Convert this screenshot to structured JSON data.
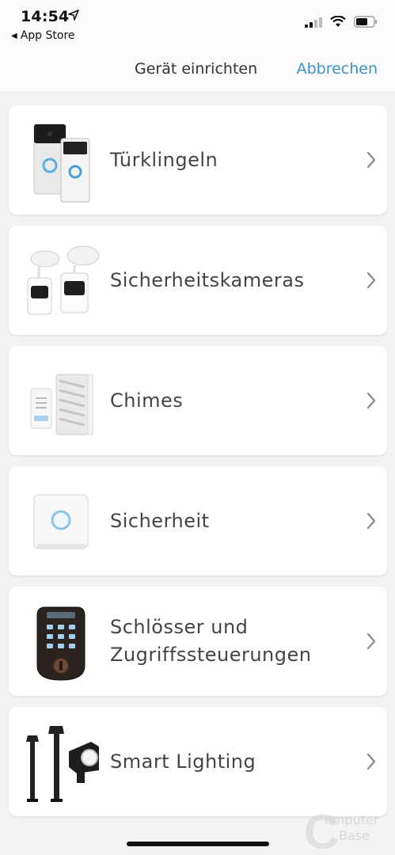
{
  "status": {
    "time": "14:54",
    "back_app": "App Store"
  },
  "nav": {
    "title": "Gerät einrichten",
    "cancel": "Abbrechen"
  },
  "categories": [
    {
      "label": "Türklingeln"
    },
    {
      "label": "Sicherheitskameras"
    },
    {
      "label": "Chimes"
    },
    {
      "label": "Sicherheit"
    },
    {
      "label": "Schlösser und Zugriffssteuerungen"
    },
    {
      "label": "Smart Lighting"
    }
  ],
  "watermark": {
    "line1": "omputer",
    "line2": "Base"
  },
  "colors": {
    "accent": "#3a92c6",
    "card_bg": "#ffffff",
    "page_bg": "#f3f3f3"
  }
}
